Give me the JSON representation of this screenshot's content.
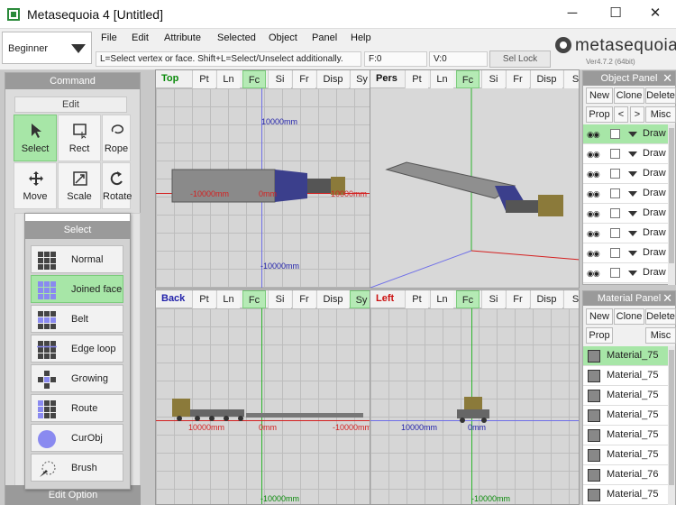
{
  "window": {
    "title": "Metasequoia 4 [Untitled]",
    "minimize": "─",
    "maximize": "☐",
    "close": "✕"
  },
  "mode": {
    "label": "Beginner"
  },
  "menu": [
    "File",
    "Edit",
    "Attribute",
    "Selected",
    "Object",
    "Panel",
    "Help"
  ],
  "status": {
    "help": "L=Select vertex or face.  Shift+L=Select/Unselect additionally.",
    "faces": "F:0",
    "vertices": "V:0",
    "sel_lock": "Sel Lock"
  },
  "logo": {
    "text": "metasequoia",
    "number": "4",
    "version": "Ver4.7.2 (64bit)"
  },
  "command_panel": {
    "title": "Command",
    "edit": "Edit",
    "tools": [
      {
        "label": "Select",
        "icon": "cursor-icon",
        "active": true
      },
      {
        "label": "Rect",
        "icon": "rectangle-select-icon",
        "active": false
      },
      {
        "label": "Rope",
        "icon": "lasso-icon",
        "active": false
      },
      {
        "label": "Move",
        "icon": "move-icon",
        "active": false
      },
      {
        "label": "Scale",
        "icon": "scale-icon",
        "active": false
      },
      {
        "label": "Rotate",
        "icon": "rotate-icon",
        "active": false
      }
    ],
    "edit_option": "Edit Option"
  },
  "select_popup": {
    "title": "Select",
    "items": [
      {
        "label": "Normal",
        "icon": "normal-select-icon",
        "active": false
      },
      {
        "label": "Joined face",
        "icon": "joined-face-icon",
        "active": true
      },
      {
        "label": "Belt",
        "icon": "belt-select-icon",
        "active": false
      },
      {
        "label": "Edge loop",
        "icon": "edge-loop-icon",
        "active": false
      },
      {
        "label": "Growing",
        "icon": "growing-select-icon",
        "active": false
      },
      {
        "label": "Route",
        "icon": "route-select-icon",
        "active": false
      },
      {
        "label": "CurObj",
        "icon": "current-object-icon",
        "active": false
      },
      {
        "label": "Brush",
        "icon": "brush-select-icon",
        "active": false
      }
    ]
  },
  "viewports": {
    "top": {
      "name": "Top",
      "tabs": [
        "Pt",
        "Ln",
        "Fc",
        "Si",
        "Fr",
        "Disp",
        "Sy"
      ],
      "active": "Fc",
      "dims": {
        "v_top": "10000mm",
        "h_left": "-10000mm",
        "h_center": "0mm",
        "h_right": "10000mm",
        "v_bottom": "-10000mm"
      }
    },
    "pers": {
      "name": "Pers",
      "tabs": [
        "Pt",
        "Ln",
        "Fc",
        "Si",
        "Fr",
        "Disp",
        "S"
      ],
      "active": "Fc"
    },
    "back": {
      "name": "Back",
      "tabs": [
        "Pt",
        "Ln",
        "Fc",
        "Si",
        "Fr",
        "Disp",
        "Sy"
      ],
      "active": "Fc",
      "dims": {
        "h_left": "10000mm",
        "h_center": "0mm",
        "h_right": "-10000mm",
        "v_bottom": "-10000mm"
      }
    },
    "left": {
      "name": "Left",
      "tabs": [
        "Pt",
        "Ln",
        "Fc",
        "Si",
        "Fr",
        "Disp",
        "S"
      ],
      "active": "Fc",
      "dims": {
        "h_left": "10000mm",
        "h_center": "0mm",
        "v_bottom": "-10000mm"
      }
    }
  },
  "object_panel": {
    "title": "Object Panel",
    "buttons": [
      "New",
      "Clone",
      "Delete"
    ],
    "buttons2": [
      "Prop",
      "<",
      ">",
      "Misc"
    ],
    "rows": [
      {
        "name": "Draw",
        "active": true
      },
      {
        "name": "Draw",
        "active": false
      },
      {
        "name": "Draw",
        "active": false
      },
      {
        "name": "Draw",
        "active": false
      },
      {
        "name": "Draw",
        "active": false
      },
      {
        "name": "Draw",
        "active": false
      },
      {
        "name": "Draw",
        "active": false
      },
      {
        "name": "Draw",
        "active": false
      }
    ]
  },
  "material_panel": {
    "title": "Material Panel",
    "buttons": [
      "New",
      "Clone",
      "Delete"
    ],
    "buttons2": [
      "Prop",
      "Misc"
    ],
    "rows": [
      {
        "name": "Material_75",
        "active": true
      },
      {
        "name": "Material_75",
        "active": false
      },
      {
        "name": "Material_75",
        "active": false
      },
      {
        "name": "Material_75",
        "active": false
      },
      {
        "name": "Material_75",
        "active": false
      },
      {
        "name": "Material_75",
        "active": false
      },
      {
        "name": "Material_76",
        "active": false
      },
      {
        "name": "Material_75",
        "active": false
      }
    ]
  },
  "colors": {
    "active_green": "#a7e6a7",
    "axis_red": "#d42020",
    "axis_green": "#2db52d",
    "axis_blue": "#6f6fe8",
    "viewport_label_green": "#0a8a0a",
    "viewport_label_red": "#cc1111",
    "viewport_label_blue": "#2222aa"
  }
}
